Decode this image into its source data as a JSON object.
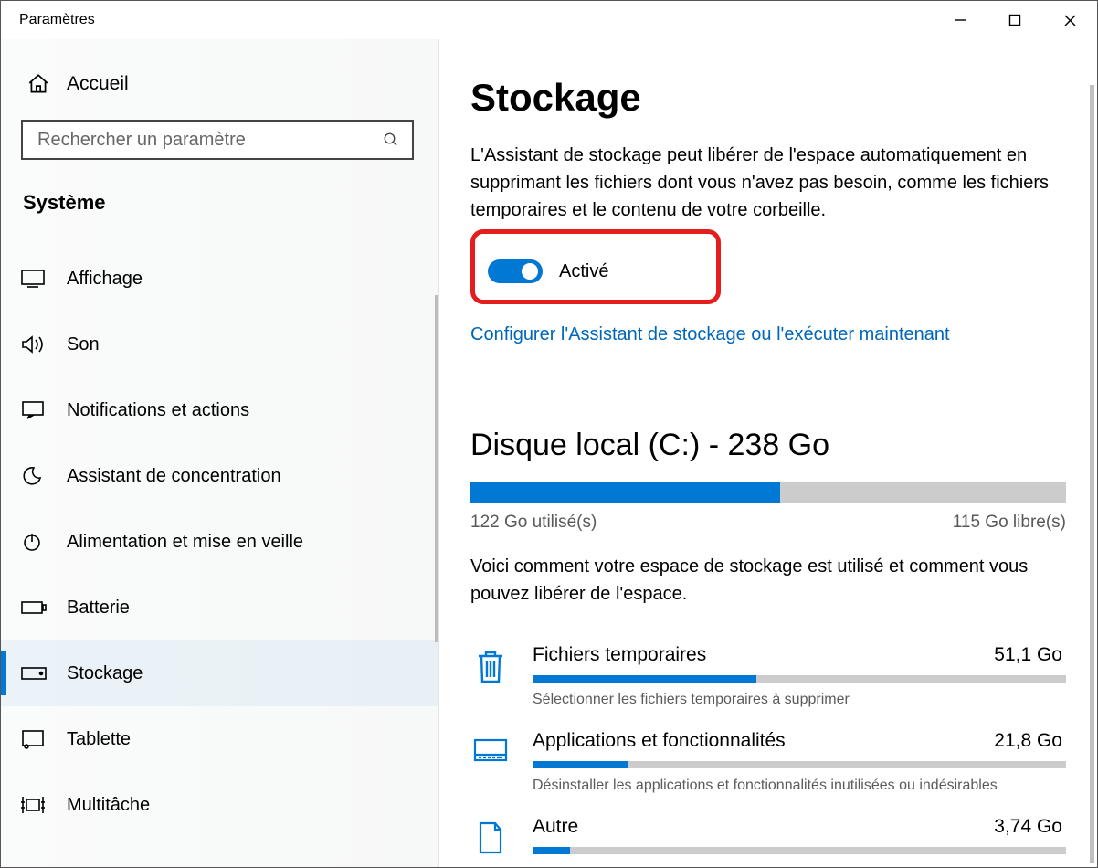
{
  "window": {
    "title": "Paramètres"
  },
  "sidebar": {
    "home": "Accueil",
    "search_placeholder": "Rechercher un paramètre",
    "section_title": "Système",
    "items": [
      {
        "label": "Affichage"
      },
      {
        "label": "Son"
      },
      {
        "label": "Notifications et actions"
      },
      {
        "label": "Assistant de concentration"
      },
      {
        "label": "Alimentation et mise en veille"
      },
      {
        "label": "Batterie"
      },
      {
        "label": "Stockage"
      },
      {
        "label": "Tablette"
      },
      {
        "label": "Multitâche"
      }
    ]
  },
  "main": {
    "title": "Stockage",
    "description": "L'Assistant de stockage peut libérer de l'espace automatiquement en supprimant les fichiers dont vous n'avez pas besoin, comme les fichiers temporaires et le contenu de votre corbeille.",
    "toggle_label": "Activé",
    "toggle_state": "on",
    "config_link": "Configurer l'Assistant de stockage ou l'exécuter maintenant",
    "disk": {
      "title": "Disque local (C:) - 238 Go",
      "used_label": "122 Go utilisé(s)",
      "free_label": "115 Go libre(s)",
      "used_percent": 52
    },
    "usage_desc": "Voici comment votre espace de stockage est utilisé et comment vous pouvez libérer de l'espace.",
    "categories": [
      {
        "label": "Fichiers temporaires",
        "size": "51,1 Go",
        "sub": "Sélectionner les fichiers temporaires à supprimer",
        "percent": 42
      },
      {
        "label": "Applications et fonctionnalités",
        "size": "21,8 Go",
        "sub": "Désinstaller les applications et fonctionnalités inutilisées ou indésirables",
        "percent": 18
      },
      {
        "label": "Autre",
        "size": "3,74 Go",
        "sub": "",
        "percent": 7
      }
    ]
  },
  "colors": {
    "accent": "#0078D4",
    "link": "#0067b8",
    "highlight": "#e41d1d"
  }
}
